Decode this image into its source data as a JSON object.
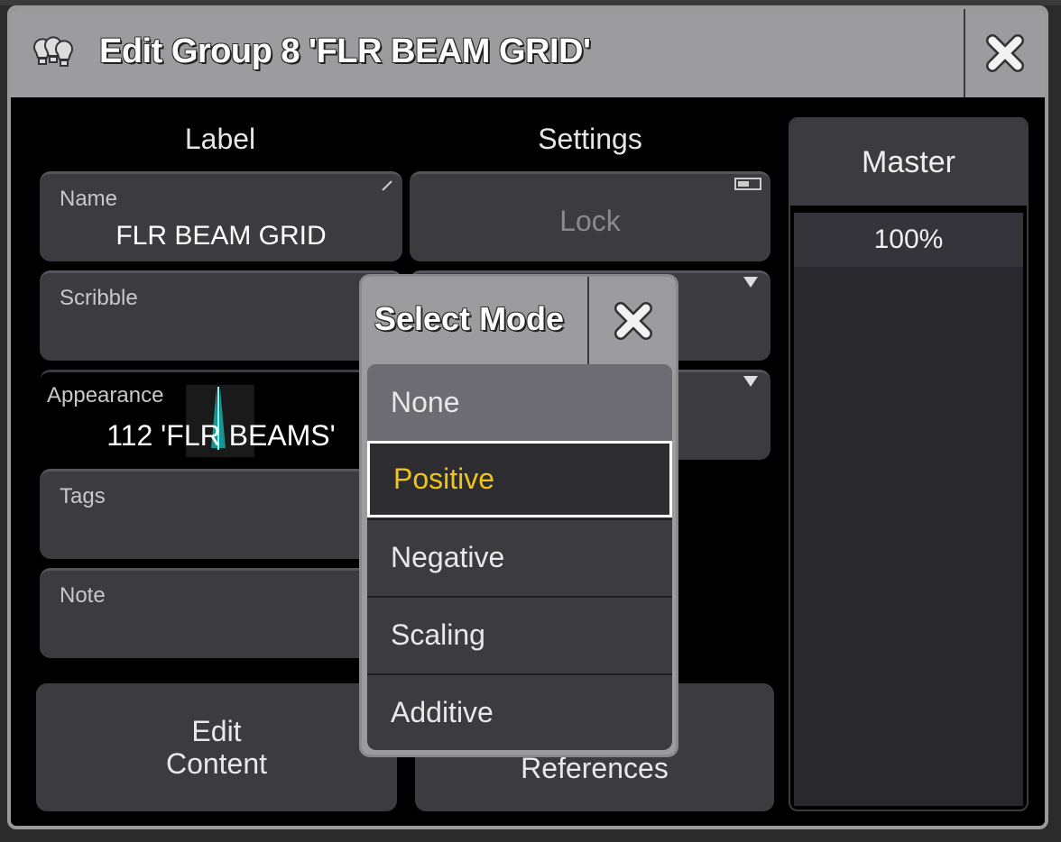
{
  "dialog": {
    "title": "Edit Group 8 'FLR BEAM GRID'"
  },
  "label_section": {
    "header": "Label",
    "name": {
      "label": "Name",
      "value": "FLR BEAM GRID"
    },
    "scribble": {
      "label": "Scribble",
      "value": ""
    },
    "appearance": {
      "label": "Appearance",
      "value": "112 'FLR BEAMS'"
    },
    "tags": {
      "label": "Tags",
      "value": ""
    },
    "note": {
      "label": "Note",
      "value": ""
    },
    "edit_content": "Edit\nContent"
  },
  "settings_section": {
    "header": "Settings",
    "lock": "Lock",
    "references": "References"
  },
  "master": {
    "header": "Master",
    "value": "100%"
  },
  "popup": {
    "title": "Select Mode",
    "options": [
      "None",
      "Positive",
      "Negative",
      "Scaling",
      "Additive"
    ],
    "selected": "Positive",
    "highlight_color": "#f0c419"
  },
  "icons": {
    "title": "fixtures-icon",
    "close": "close-x-icon"
  }
}
